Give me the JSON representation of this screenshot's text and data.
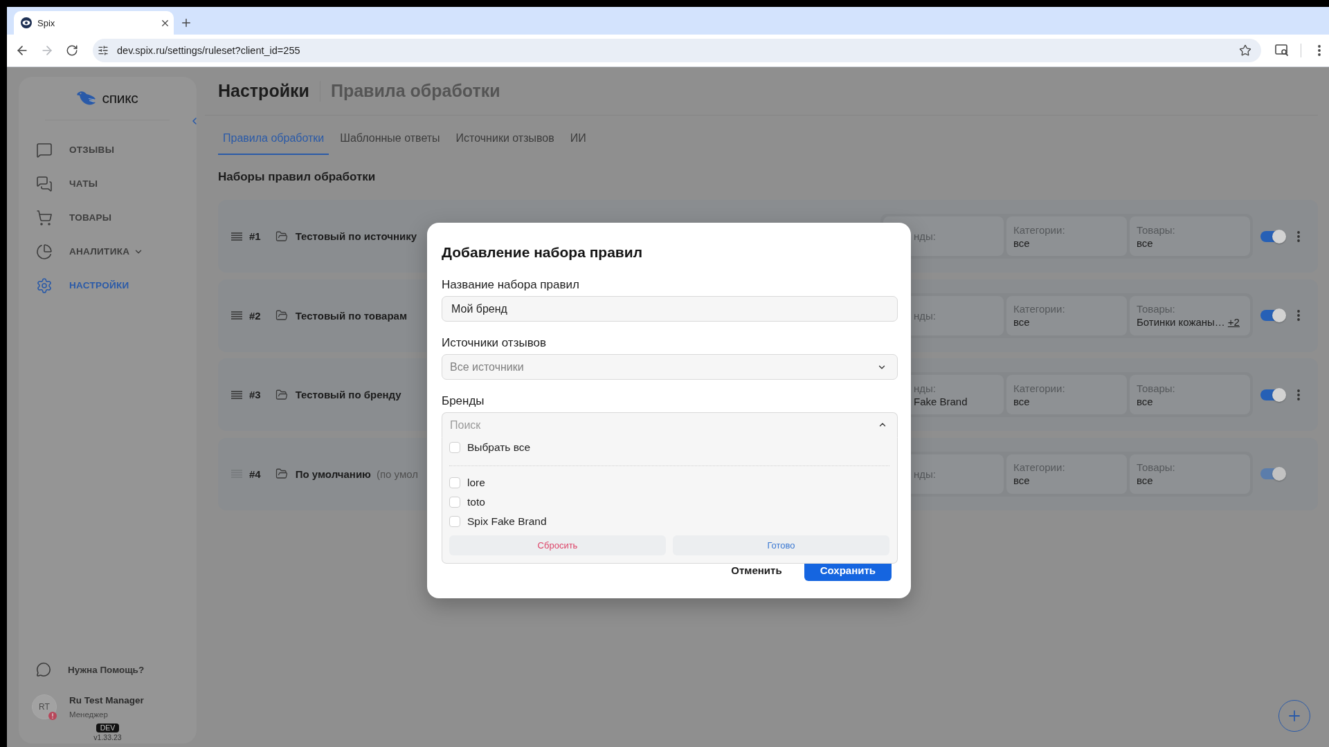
{
  "browser": {
    "tab_title": "Spix",
    "url": "dev.spix.ru/settings/ruleset?client_id=255"
  },
  "sidebar": {
    "logo_text": "спикс",
    "items": [
      {
        "label": "ОТЗЫВЫ",
        "kind": "link",
        "selected": false
      },
      {
        "label": "ЧАТЫ",
        "kind": "link",
        "selected": false
      },
      {
        "label": "ТОВАРЫ",
        "kind": "link",
        "selected": false
      },
      {
        "label": "АНАЛИТИКА",
        "kind": "group",
        "selected": false
      },
      {
        "label": "НАСТРОЙКИ",
        "kind": "link",
        "selected": true
      }
    ],
    "help": "Нужна Помощь?",
    "user": {
      "initials": "RT",
      "name": "Ru Test Manager",
      "role": "Менеджер",
      "alert": true
    },
    "env_badge": "DEV",
    "version": "v1.33.23"
  },
  "header": {
    "title": "Настройки",
    "subtitle": "Правила обработки"
  },
  "tabs": [
    {
      "label": "Правила обработки",
      "selected": true
    },
    {
      "label": "Шаблонные ответы",
      "selected": false
    },
    {
      "label": "Источники отзывов",
      "selected": false
    },
    {
      "label": "ИИ",
      "selected": false
    }
  ],
  "section_title": "Наборы правил обработки",
  "rulesets": [
    {
      "number": "#1",
      "name": "Тестовый по источнику",
      "enabled": true,
      "disabled": false,
      "menu": true,
      "filters": [
        {
          "label": "нды:"
        },
        {
          "label": "Категории:",
          "value": "все"
        },
        {
          "label": "Товары:",
          "value": "все"
        }
      ]
    },
    {
      "number": "#2",
      "name": "Тестовый по товарам",
      "enabled": true,
      "disabled": false,
      "menu": true,
      "filters": [
        {
          "label": "нды:"
        },
        {
          "label": "Категории:",
          "value": "все"
        },
        {
          "label": "Товары:",
          "value": "Ботинки кожаны…",
          "more": "+2"
        }
      ]
    },
    {
      "number": "#3",
      "name": "Тестовый по бренду",
      "enabled": true,
      "disabled": false,
      "menu": true,
      "filters": [
        {
          "label": "нды:",
          "value": "Fake Brand"
        },
        {
          "label": "Категории:",
          "value": "все"
        },
        {
          "label": "Товары:",
          "value": "все"
        }
      ]
    },
    {
      "number": "#4",
      "name": "По умолчанию",
      "note": "(по умол",
      "enabled": true,
      "disabled": true,
      "menu": false,
      "filters": [
        {
          "label": "нды:"
        },
        {
          "label": "Категории:",
          "value": "все"
        },
        {
          "label": "Товары:",
          "value": "все"
        }
      ]
    }
  ],
  "dialog": {
    "title": "Добавление набора правил",
    "name_field": {
      "label": "Название набора правил",
      "value": "Мой бренд"
    },
    "sources_field": {
      "label": "Источники отзывов",
      "placeholder": "Все источники",
      "expanded": false
    },
    "brands_field": {
      "label": "Бренды",
      "placeholder": "Поиск",
      "expanded": true,
      "select_all": {
        "label": "Выбрать все",
        "checked": false
      },
      "options": [
        {
          "label": "lore",
          "checked": false
        },
        {
          "label": "toto",
          "checked": false
        },
        {
          "label": "Spix Fake Brand",
          "checked": false
        }
      ],
      "reset": "Сбросить",
      "done": "Готово"
    },
    "cancel": "Отменить",
    "save": "Сохранить"
  }
}
